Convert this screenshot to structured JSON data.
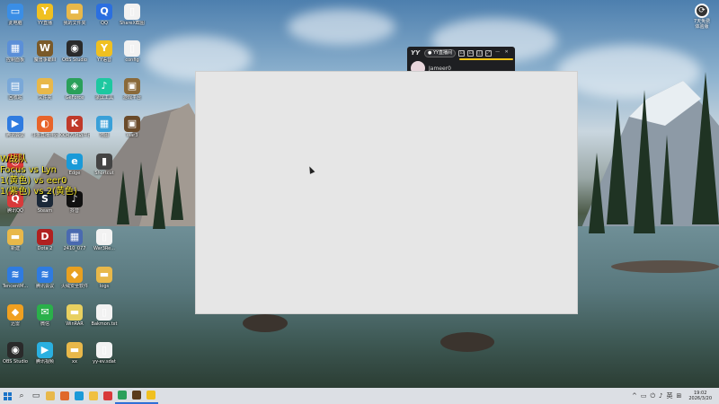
{
  "desktop": {
    "icons": [
      {
        "label": "此电脑",
        "glyph": "▭",
        "color": "#3a8ee6"
      },
      {
        "label": "YY直播",
        "glyph": "Y",
        "color": "#f0c020"
      },
      {
        "label": "我的文件夹",
        "glyph": "▬",
        "color": "#e8b84a"
      },
      {
        "label": "QQ",
        "glyph": "Q",
        "color": "#2b6fe0"
      },
      {
        "label": "ShareX截图",
        "glyph": "▯",
        "color": "#f2f2f2"
      },
      {
        "label": "控制面板",
        "glyph": "▦",
        "color": "#5b8fd8"
      },
      {
        "label": "魔兽争霸III",
        "glyph": "W",
        "color": "#7a5a2a"
      },
      {
        "label": "OBS Studio",
        "glyph": "◉",
        "color": "#2a2a2a"
      },
      {
        "label": "YY语音",
        "glyph": "Y",
        "color": "#f0c020"
      },
      {
        "label": "config",
        "glyph": "▯",
        "color": "#f2f2f2"
      },
      {
        "label": "回收站",
        "glyph": "▤",
        "color": "#7aa8d8"
      },
      {
        "label": "文件夹",
        "glyph": "▬",
        "color": "#e8b84a"
      },
      {
        "label": "GeForce",
        "glyph": "◈",
        "color": "#2aa05a"
      },
      {
        "label": "录屏工具",
        "glyph": "♪",
        "color": "#1ec8a0"
      },
      {
        "label": "游戏平台",
        "glyph": "▣",
        "color": "#8a6a3a"
      },
      {
        "label": "腾讯会议",
        "glyph": "▶",
        "color": "#2f7be0"
      },
      {
        "label": "斗鱼直播伴侣",
        "glyph": "◐",
        "color": "#e8642a"
      },
      {
        "label": "KK官方对战平台",
        "glyph": "K",
        "color": "#c03a2a"
      },
      {
        "label": "地图",
        "glyph": "▦",
        "color": "#3aa0d8"
      },
      {
        "label": "War3",
        "glyph": "▣",
        "color": "#6a4a2a"
      },
      {
        "label": "网易云",
        "glyph": "◎",
        "color": "#e03a3a"
      },
      {
        "label": "Edge",
        "glyph": "e",
        "color": "#1a9ad8"
      },
      {
        "label": "Shortcut",
        "glyph": "▮",
        "color": "#444"
      },
      {
        "label": "腾讯QQ",
        "glyph": "Q",
        "color": "#d83a3a"
      },
      {
        "label": "Steam",
        "glyph": "S",
        "color": "#1b2838"
      },
      {
        "label": "抖音",
        "glyph": "♪",
        "color": "#111"
      },
      {
        "label": "新建",
        "glyph": "▬",
        "color": "#e8b84a"
      },
      {
        "label": "Dota 2",
        "glyph": "D",
        "color": "#b02020"
      },
      {
        "label": "2410_077",
        "glyph": "▦",
        "color": "#4a6ab0"
      },
      {
        "label": "War3Re...",
        "glyph": "▯",
        "color": "#f2f2f2"
      },
      {
        "label": "TencentM...",
        "glyph": "≋",
        "color": "#2f7be0"
      },
      {
        "label": "腾讯会议",
        "glyph": "≋",
        "color": "#2f7be0"
      },
      {
        "label": "火绒安全软件",
        "glyph": "◆",
        "color": "#e8a020"
      },
      {
        "label": "logs",
        "glyph": "▬",
        "color": "#e8b84a"
      },
      {
        "label": "迅雷",
        "glyph": "◆",
        "color": "#f0a020"
      },
      {
        "label": "微信",
        "glyph": "✉",
        "color": "#2ab04a"
      },
      {
        "label": "WinRAR",
        "glyph": "▬",
        "color": "#e8d060"
      },
      {
        "label": "Bakmon.txt",
        "glyph": "▯",
        "color": "#f2f2f2"
      },
      {
        "label": "OBS Studio",
        "glyph": "◉",
        "color": "#2a2a2a"
      },
      {
        "label": "腾讯视频",
        "glyph": "▶",
        "color": "#2ab0e0"
      },
      {
        "label": "xx",
        "glyph": "▬",
        "color": "#e8b84a"
      },
      {
        "label": "yy-ev.sdat",
        "glyph": "▯",
        "color": "#f2f2f2"
      }
    ],
    "overlay_text": [
      "W战队",
      "Focus vs Lyn",
      "1(黄色) vs eer0",
      "1(紫色) vs 2(黄色)"
    ],
    "top_right_icon": {
      "label": "7天免费\n体验版"
    }
  },
  "yy_window": {
    "logo": "YY",
    "badge": "● YY直播间",
    "controls": [
      "⊡",
      "⊡",
      "◫",
      "⤢",
      "—",
      "✕"
    ],
    "username": "Jameer0"
  },
  "taskbar": {
    "items": [
      {
        "name": "search",
        "glyph": "⌕",
        "color": "#333"
      },
      {
        "name": "task-view",
        "glyph": "▭",
        "color": "#333"
      },
      {
        "name": "explorer",
        "glyph": "",
        "color": "#e8b84a"
      },
      {
        "name": "app-orange",
        "glyph": "",
        "color": "#e0682a"
      },
      {
        "name": "edge",
        "glyph": "",
        "color": "#1a9ad8"
      },
      {
        "name": "folder",
        "glyph": "",
        "color": "#f0c040"
      },
      {
        "name": "netease",
        "glyph": "",
        "color": "#d83a3a"
      },
      {
        "name": "geforce",
        "glyph": "",
        "color": "#2aa05a"
      },
      {
        "name": "warcraft",
        "glyph": "",
        "color": "#5a3a1a"
      },
      {
        "name": "yy",
        "glyph": "",
        "color": "#f0c020"
      }
    ],
    "tray": [
      "^",
      "▭",
      "⏻",
      "♪",
      "英",
      "⊞"
    ],
    "time": "19:02",
    "date": "2026/3/20"
  }
}
